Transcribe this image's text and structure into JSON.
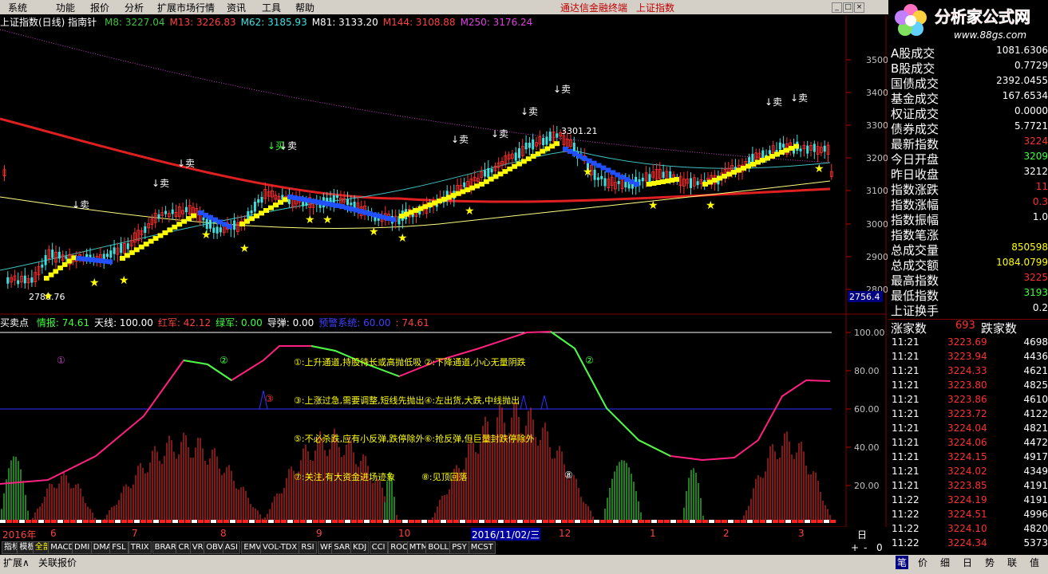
{
  "menu": {
    "items": [
      "系统",
      "功能",
      "报价",
      "分析",
      "扩展市场行情",
      "资讯",
      "工具",
      "帮助"
    ],
    "promo1": "通达信金融终端",
    "promo2": "上证指数"
  },
  "logo": {
    "title": "分析家公式网",
    "url": "www.88gs.com"
  },
  "header": {
    "index_name": "上证指数(日线) 指南针",
    "ma": [
      {
        "label": "M8: 3227.04",
        "color": "#40c040"
      },
      {
        "label": "M13: 3226.83",
        "color": "#ff4040"
      },
      {
        "label": "M62: 3185.93",
        "color": "#40e0e0"
      },
      {
        "label": "M81: 3133.20",
        "color": "#ffffff"
      },
      {
        "label": "M144: 3108.88",
        "color": "#ff4040"
      },
      {
        "label": "M250: 3176.24",
        "color": "#e040e0"
      }
    ]
  },
  "main_chart": {
    "y_ticks": [
      "3500",
      "3400",
      "3300",
      "3200",
      "3100",
      "3000",
      "2900",
      "2800"
    ],
    "price_box": "2756.4",
    "high_label": "3301.21",
    "low_label": "2780.76",
    "sell_label": "卖",
    "sell_label_green": "买"
  },
  "indicator": {
    "name": "买卖点",
    "items": [
      {
        "label": "情报: 74.61",
        "color": "#40ff40"
      },
      {
        "label": "天线: 100.00",
        "color": "#ffffff"
      },
      {
        "label": "红军: 42.12",
        "color": "#ff4040"
      },
      {
        "label": "绿军: 0.00",
        "color": "#40ff40"
      },
      {
        "label": "导弹: 0.00",
        "color": "#ffffff"
      },
      {
        "label": "预警系统: 60.00",
        "color": "#4040ff"
      },
      {
        "label": ": 74.61",
        "color": "#ff4040"
      }
    ],
    "y_ticks": [
      "100.00",
      "80.00",
      "60.00",
      "40.00",
      "20.00"
    ],
    "notes": [
      "①:上升通道,持股待长或高抛低吸 ②:下降通道,小心无量阴跌",
      "③:上涨过急,需要调整,短线先抛出④:左出货,大跌,中线抛出",
      "⑤:不必杀跌,应有小反弹,跌停除外⑥:抢反弹,但巨量封跌停除外",
      "⑦:关注,有大资金进场迹象",
      "⑧:见顶回落"
    ],
    "markers": [
      "①",
      "②",
      "②",
      "③",
      "⑧"
    ]
  },
  "time_axis": {
    "labels": [
      "2016年",
      "6",
      "7",
      "8",
      "9",
      "10",
      "2016/11/02/三",
      "12",
      "1",
      "2",
      "3"
    ],
    "period": "日线"
  },
  "tabs": [
    "指标",
    "模板",
    "全部",
    "MACD",
    "DMI",
    "DMA",
    "FSL",
    "TRIX",
    "BRAR",
    "CR",
    "VR",
    "OBV",
    "ASI",
    "EMV",
    "VOL-TDX",
    "RSI",
    "WR",
    "SAR",
    "KDJ",
    "CCI",
    "ROC",
    "MTM",
    "BOLL",
    "PSY",
    "MCST"
  ],
  "bottom": {
    "left_tabs": [
      "扩展∧",
      "关联报价"
    ],
    "right_tabs": [
      "笔",
      "价",
      "细",
      "日",
      "势",
      "联",
      "值"
    ]
  },
  "right_panel": {
    "quote_rows": [
      {
        "k": "A股成交",
        "v": "1081.6306",
        "c": "#ffffff"
      },
      {
        "k": "B股成交",
        "v": "0.7729",
        "c": "#ffffff"
      },
      {
        "k": "国债成交",
        "v": "2392.0455",
        "c": "#ffffff"
      },
      {
        "k": "基金成交",
        "v": "167.6534",
        "c": "#ffffff"
      },
      {
        "k": "权证成交",
        "v": "0.0000",
        "c": "#ffffff"
      },
      {
        "k": "债券成交",
        "v": "5.7721",
        "c": "#ffffff"
      },
      {
        "k": "最新指数",
        "v": "3224",
        "c": "#ff3030"
      },
      {
        "k": "今日开盘",
        "v": "3209",
        "c": "#40ff40"
      },
      {
        "k": "昨日收盘",
        "v": "3212",
        "c": "#ffffff"
      },
      {
        "k": "指数涨跌",
        "v": "11",
        "c": "#ff3030"
      },
      {
        "k": "指数涨幅",
        "v": "0.3",
        "c": "#ff3030"
      },
      {
        "k": "指数振幅",
        "v": "1.0",
        "c": "#ffffff"
      },
      {
        "k": "指数笔涨",
        "v": "",
        "c": "#ffffff"
      },
      {
        "k": "总成交量",
        "v": "850598",
        "c": "#ffff00"
      },
      {
        "k": "总成交额",
        "v": "1084.0799",
        "c": "#ffff00"
      },
      {
        "k": "最高指数",
        "v": "3225",
        "c": "#ff3030"
      },
      {
        "k": "最低指数",
        "v": "3193",
        "c": "#40ff40"
      },
      {
        "k": "上证换手",
        "v": "0.2",
        "c": "#ffffff"
      }
    ],
    "updown": {
      "up_label": "涨家数",
      "up": "693",
      "down_label": "跌家数"
    },
    "ticks": [
      {
        "t": "11:21",
        "p": "3223.69",
        "q": "4698"
      },
      {
        "t": "11:21",
        "p": "3223.94",
        "q": "4436"
      },
      {
        "t": "11:21",
        "p": "3224.33",
        "q": "4621"
      },
      {
        "t": "11:21",
        "p": "3223.80",
        "q": "4825"
      },
      {
        "t": "11:21",
        "p": "3223.86",
        "q": "4610"
      },
      {
        "t": "11:21",
        "p": "3223.72",
        "q": "4122"
      },
      {
        "t": "11:21",
        "p": "3224.04",
        "q": "4821"
      },
      {
        "t": "11:21",
        "p": "3224.06",
        "q": "4472"
      },
      {
        "t": "11:21",
        "p": "3224.15",
        "q": "4917"
      },
      {
        "t": "11:21",
        "p": "3224.02",
        "q": "4349"
      },
      {
        "t": "11:21",
        "p": "3223.85",
        "q": "4191"
      },
      {
        "t": "11:22",
        "p": "3224.19",
        "q": "4191"
      },
      {
        "t": "11:22",
        "p": "3224.51",
        "q": "4996"
      },
      {
        "t": "11:22",
        "p": "3224.10",
        "q": "4820"
      },
      {
        "t": "11:22",
        "p": "3224.34",
        "q": "5373"
      }
    ]
  },
  "colors": {
    "up": "#ff3030",
    "down": "#40ff40",
    "menu_bg": "#d4d0c8"
  }
}
